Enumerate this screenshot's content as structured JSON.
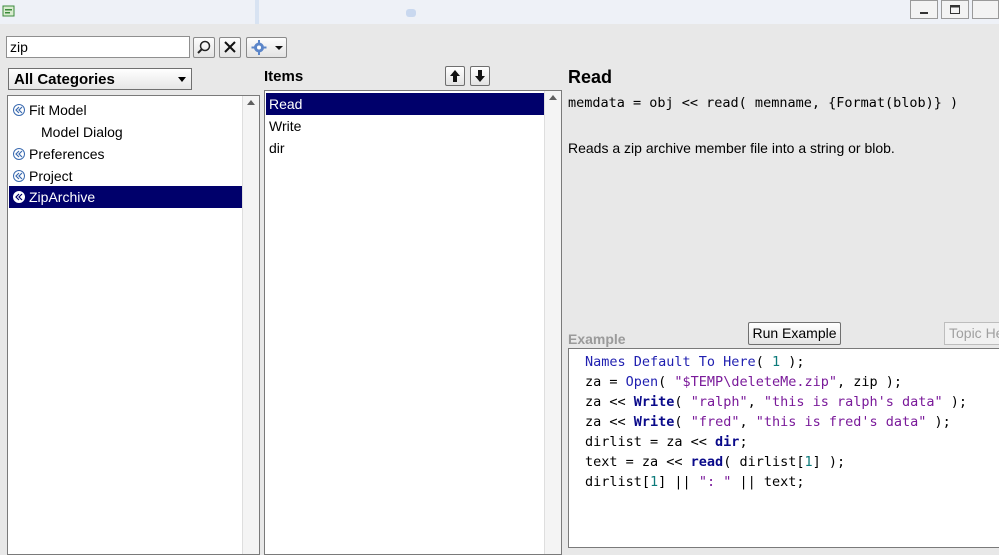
{
  "titlebar": {
    "minimize_label": "",
    "restore_label": "",
    "close_label": ""
  },
  "search": {
    "value": "zip"
  },
  "categories": {
    "selected": "All Categories"
  },
  "tree": {
    "items": [
      {
        "label": "Fit Model",
        "icon": "collapse-icon",
        "indent": 0,
        "selected": false
      },
      {
        "label": "Model Dialog",
        "icon": "",
        "indent": 1,
        "selected": false
      },
      {
        "label": "Preferences",
        "icon": "collapse-icon",
        "indent": 0,
        "selected": false
      },
      {
        "label": "Project",
        "icon": "collapse-icon",
        "indent": 0,
        "selected": false
      },
      {
        "label": "ZipArchive",
        "icon": "collapse-icon",
        "indent": 0,
        "selected": true
      }
    ]
  },
  "items_panel": {
    "title": "Items",
    "items": [
      "Read",
      "Write",
      "dir"
    ],
    "selected": "Read"
  },
  "detail": {
    "title": "Read",
    "syntax": "memdata = obj << read( memname, {Format(blob)} )",
    "description": "Reads a zip archive member file into a string or blob."
  },
  "example": {
    "label": "Example",
    "run_button": "Run Example",
    "topic_button": "Topic He",
    "code": [
      "Names Default To Here( 1 );",
      "za = Open( \"$TEMP\\deleteMe.zip\", zip );",
      "za << Write( \"ralph\", \"this is ralph's data\" );",
      "za << Write( \"fred\", \"this is fred's data\" );",
      "dirlist = za << dir;",
      "text = za << read( dirlist[1] );",
      "dirlist[1] || \": \" || text;"
    ]
  },
  "colors": {
    "selection": "#00006b",
    "keyword": "#1f1fb0",
    "string": "#7a1a9a",
    "number": "#0c7a7a"
  }
}
